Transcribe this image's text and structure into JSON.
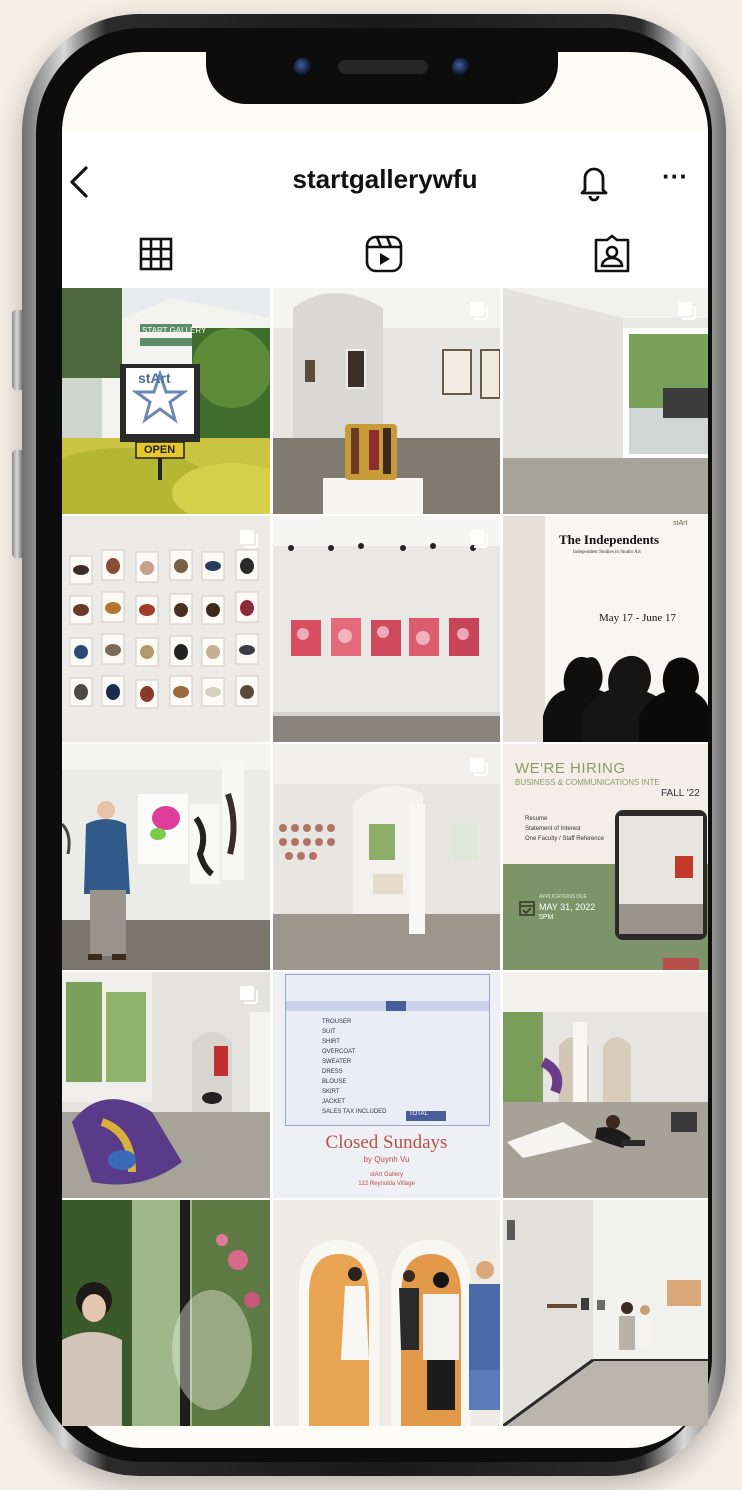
{
  "profile": {
    "username": "startgallerywfu"
  },
  "icons": {
    "back": "chevron-left-icon",
    "notifications": "bell-icon",
    "more": "more-horizontal-icon",
    "grid_tab": "grid-icon",
    "reels_tab": "reels-icon",
    "tagged_tab": "tagged-icon"
  },
  "more_glyph": "···",
  "grid_posts": [
    {
      "id": "post-1",
      "sign_text": "START GALLERY",
      "sign_logo": "stArt",
      "open_text": "OPEN"
    },
    {
      "id": "post-2"
    },
    {
      "id": "post-3"
    },
    {
      "id": "post-4"
    },
    {
      "id": "post-5"
    },
    {
      "id": "post-6",
      "title": "The Independents",
      "subtitle": "Independent Studies in Studio Art",
      "dates": "May 17 - June 17",
      "logo": "stArt"
    },
    {
      "id": "post-7"
    },
    {
      "id": "post-8"
    },
    {
      "id": "post-9",
      "heading": "WE'RE HIRING",
      "subheading": "BUSINESS & COMMUNICATIONS INTE",
      "season": "FALL '22",
      "items": [
        "Resume",
        "Statement of Interest",
        "One Faculty / Staff Reference"
      ],
      "due_label": "APPLICATIONS DUE",
      "due_date": "MAY 31, 2022",
      "due_time": "5PM"
    },
    {
      "id": "post-10"
    },
    {
      "id": "post-11",
      "title": "Closed Sundays",
      "byline": "by Quynh Vu",
      "venue": "stArt Gallery",
      "address": "122 Reynolda Village",
      "ticket_rows": [
        "TROUSER",
        "SUIT",
        "SHIRT",
        "OVERCOAT",
        "SWEATER",
        "DRESS",
        "BLOUSE",
        "SKIRT",
        "JACKET",
        "SALES TAX INCLUDED"
      ],
      "total": "TOTAL"
    },
    {
      "id": "post-12"
    },
    {
      "id": "post-13"
    },
    {
      "id": "post-14"
    },
    {
      "id": "post-15"
    }
  ],
  "colors": {
    "background": "#f5efe6",
    "hiring_green": "#7c9468",
    "closed_red": "#b8504a",
    "independents_paper": "#f4f2ee"
  }
}
